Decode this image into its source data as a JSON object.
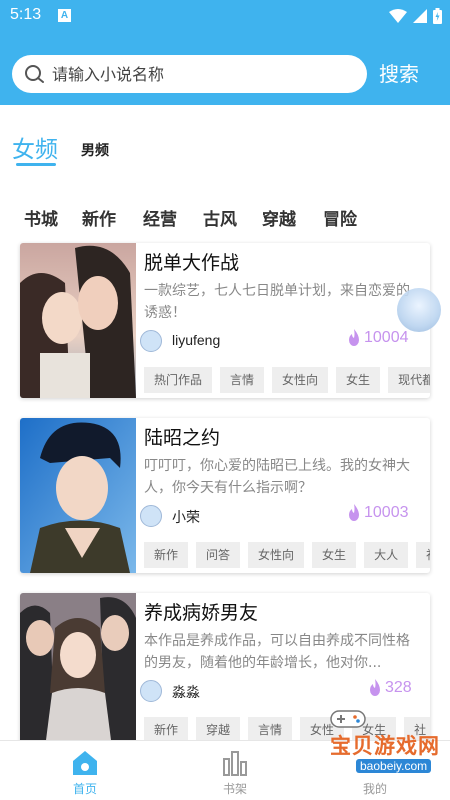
{
  "status_bar": {
    "time": "5:13",
    "notification_letter": "A"
  },
  "search": {
    "placeholder": "请输入小说名称",
    "button_label": "搜索"
  },
  "gender_tabs": {
    "female": "女频",
    "male": "男频"
  },
  "category_tabs": [
    "书城",
    "新作",
    "经营",
    "古风",
    "穿越",
    "冒险"
  ],
  "books": [
    {
      "title": "脱单大作战",
      "description": "一款综艺，七人七日脱单计划，来自恋爱的诱惑！",
      "author": "liyufeng",
      "hot": "10004",
      "tags": [
        "热门作品",
        "言情",
        "女性向",
        "女生",
        "现代都"
      ]
    },
    {
      "title": "陆昭之约",
      "description": "叮叮叮，你心爱的陆昭已上线。我的女神大人，你今天有什么指示啊？",
      "author": "小荣",
      "hot": "10003",
      "tags": [
        "新作",
        "问答",
        "女性向",
        "女生",
        "大人",
        "社"
      ]
    },
    {
      "title": "养成病娇男友",
      "description": "本作品是养成作品，可以自由养成不同性格的男友，随着他的年龄增长，他对你...",
      "author": "淼淼",
      "hot": "328",
      "tags": [
        "新作",
        "穿越",
        "言情",
        "女性",
        "女生",
        "社"
      ]
    }
  ],
  "bottom_nav": {
    "home": "首页",
    "bookshelf": "书架",
    "mine": "我的"
  },
  "watermark": {
    "text": "宝贝游戏网",
    "url": "baobeiy.com"
  },
  "colors": {
    "primary": "#3fb3ee",
    "hot": "#c693ee",
    "tag_bg": "#eeeeee"
  }
}
